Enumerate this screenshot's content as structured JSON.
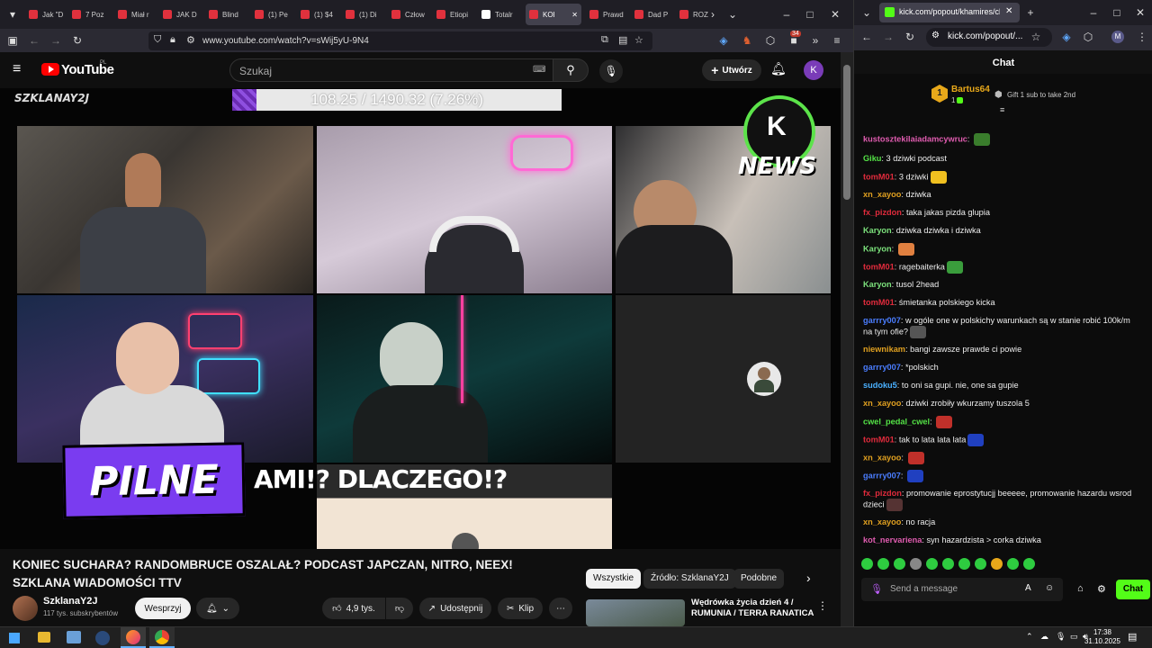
{
  "left_browser": {
    "tabs": [
      {
        "label": "Jak \"D",
        "color": "#e0313d"
      },
      {
        "label": "7 Poz",
        "color": "#e0313d"
      },
      {
        "label": "Miał r",
        "color": "#e0313d"
      },
      {
        "label": "JAK D",
        "color": "#e0313d"
      },
      {
        "label": "Blind",
        "color": "#e0313d"
      },
      {
        "label": "(1) Pe",
        "color": "#e0313d"
      },
      {
        "label": "(1) $4",
        "color": "#e0313d"
      },
      {
        "label": "(1) Di",
        "color": "#e0313d"
      },
      {
        "label": "Człow",
        "color": "#e0313d"
      },
      {
        "label": "Etiopi",
        "color": "#e0313d"
      },
      {
        "label": "Totalr",
        "color": "#ffffff"
      },
      {
        "label": "KOI",
        "color": "#e0313d"
      },
      {
        "label": "Prawd",
        "color": "#e0313d"
      },
      {
        "label": "Dad P",
        "color": "#e0313d"
      },
      {
        "label": "ROZ",
        "color": "#e0313d"
      }
    ],
    "url": "www.youtube.com/watch?v=sWij5yU-9N4",
    "extension_badge": "34"
  },
  "youtube": {
    "logo": "YouTube",
    "logo_suffix": "PL",
    "search_placeholder": "Szukaj",
    "create_label": "Utwórz",
    "avatar_letter": "K",
    "video": {
      "channel_watermark": "SZKLANAY2J",
      "progress_text": "108.25 / 1490.32 (7.26%)",
      "progress_fraction": 0.0726,
      "news_badge": "NEWS",
      "pilne": "PILNE",
      "headline": "AMI!? DLACZEGO!?"
    },
    "title": "KONIEC SUCHARA? RANDOMBRUCE OSZALAŁ? PODCAST JAPCZAN, NITRO, NEEX! SZKLANA WIADOMOŚCI TTV",
    "channel_name": "SzklanaY2J",
    "subscribers": "117 tys. subskrybentów",
    "support_label": "Wesprzyj",
    "likes": "4,9 tys.",
    "share_label": "Udostępnij",
    "clip_label": "Klip",
    "chips": [
      "Wszystkie",
      "Źródło: SzklanaY2J",
      "Podobne"
    ],
    "recommended_title": "Wędrówka życia dzień 4 / RUMUNIA / TERRA RANATICA"
  },
  "right_browser": {
    "tab_label": "kick.com/popout/khamires/cha",
    "url": "kick.com/popout/...",
    "profile_letter": "M"
  },
  "chat": {
    "header": "Chat",
    "pinned_user": "Bartus64",
    "pinned_count": "1",
    "pinned_rank": "1",
    "gift_text": "Gift 1 sub to take 2nd",
    "messages": [
      {
        "user": "kustosztekilaiadamcywruc",
        "color": "#e05cb0",
        "text": "",
        "emote": "#3a7d2c"
      },
      {
        "user": "Giku",
        "color": "#54e346",
        "text": "3 dziwki podcast"
      },
      {
        "user": "tomM01",
        "color": "#e02b3c",
        "text": "3 dziwki",
        "emote": "#f0c020"
      },
      {
        "user": "xn_xayoo",
        "color": "#e0a020",
        "text": "dziwka"
      },
      {
        "user": "fx_pizdon",
        "color": "#e02b3c",
        "text": "taka jakas pizda glupia"
      },
      {
        "user": "Karyon",
        "color": "#7be07b",
        "text": "dziwka dziwka i dziwka"
      },
      {
        "user": "Karyon",
        "color": "#7be07b",
        "text": "",
        "emote": "#e08040"
      },
      {
        "user": "tomM01",
        "color": "#e02b3c",
        "text": "ragebaiterka",
        "emote": "#3a9d3c"
      },
      {
        "user": "Karyon",
        "color": "#7be07b",
        "text": "tusol 2head"
      },
      {
        "user": "tomM01",
        "color": "#e02b3c",
        "text": "śmietanka polskiego kicka"
      },
      {
        "user": "garrry007",
        "color": "#4a7dff",
        "text": "w ogóle one w polskichy warunkach są w stanie robić 100k/m na tym ofie?",
        "emote": "#555555"
      },
      {
        "user": "niewnikam",
        "color": "#e0a020",
        "text": "bangi zawsze prawde ci powie"
      },
      {
        "user": "garrry007",
        "color": "#4a7dff",
        "text": "*polskich"
      },
      {
        "user": "sudoku5",
        "color": "#4ab0ff",
        "text": "to oni sa gupi. nie, one sa gupie"
      },
      {
        "user": "xn_xayoo",
        "color": "#e0a020",
        "text": "dziwki zrobiły wkurzamy tuszola 5"
      },
      {
        "user": "cwel_pedal_cwel",
        "color": "#54e346",
        "text": "",
        "emote": "#c0302a"
      },
      {
        "user": "tomM01",
        "color": "#e02b3c",
        "text": "tak to lata lata lata",
        "emote": "#2040c0"
      },
      {
        "user": "xn_xayoo",
        "color": "#e0a020",
        "text": "",
        "emote": "#c0302a"
      },
      {
        "user": "garrry007",
        "color": "#4a7dff",
        "text": "",
        "emote": "#2040c0"
      },
      {
        "user": "fx_pizdon",
        "color": "#e02b3c",
        "text": "promowanie eprostytucjj beeeee, promowanie hazardu wsrod dzieci",
        "emote": "#553333"
      },
      {
        "user": "xn_xayoo",
        "color": "#e0a020",
        "text": "no racja"
      },
      {
        "user": "kot_nervariena",
        "color": "#e05cb0",
        "text": "syn hazardzista > corka dziwka"
      }
    ],
    "input_placeholder": "Send a message",
    "send_label": "Chat"
  },
  "taskbar": {
    "time": "17:38",
    "date": "31.10.2025"
  }
}
